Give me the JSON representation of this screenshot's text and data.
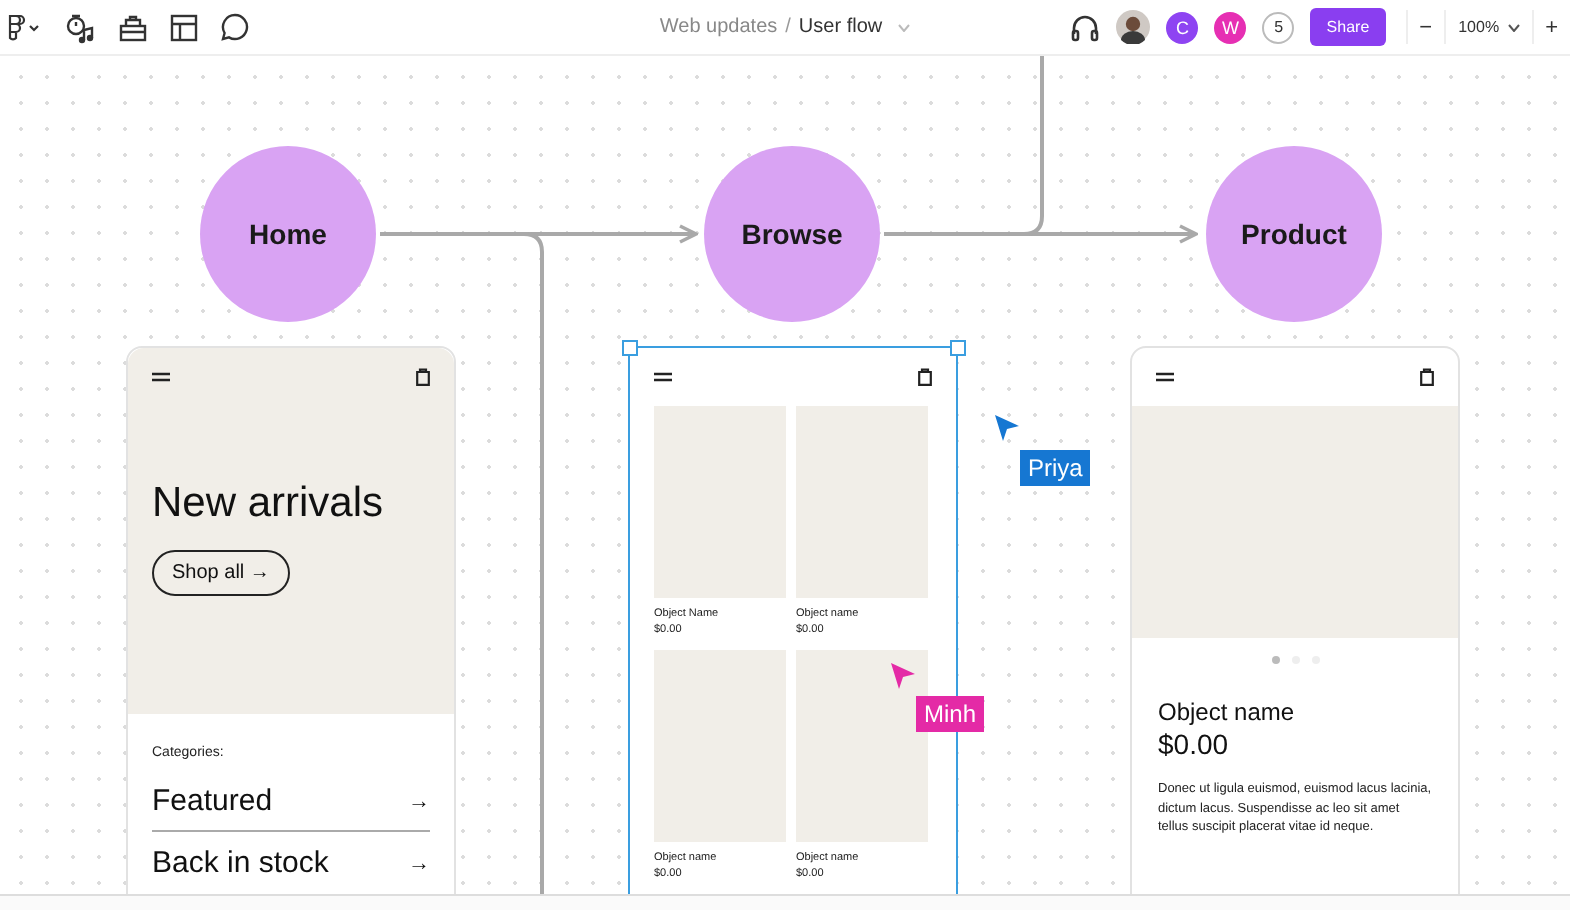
{
  "toolbar": {
    "breadcrumb": {
      "project": "Web updates",
      "separator": "/",
      "file": "User flow"
    },
    "collaborators": [
      {
        "kind": "photo"
      },
      {
        "kind": "initial",
        "initial": "C",
        "color": "#8e44f2"
      },
      {
        "kind": "initial",
        "initial": "W",
        "color": "#e62fb3"
      }
    ],
    "more_count": "5",
    "share_button": "Share",
    "zoom": {
      "minus": "−",
      "value": "100%",
      "plus": "+"
    }
  },
  "flow": {
    "nodes": [
      {
        "label": "Home"
      },
      {
        "label": "Browse"
      },
      {
        "label": "Product"
      }
    ]
  },
  "frames": [
    {
      "kind": "hero",
      "selected": false,
      "title": "New arrivals",
      "button": "Shop all →",
      "categories_label": "Categories:",
      "categories": [
        {
          "label": "Featured",
          "arrow": "→"
        },
        {
          "label": "Back in stock",
          "arrow": "→"
        }
      ]
    },
    {
      "kind": "grid",
      "selected": true,
      "products": [
        {
          "name": "Object Name",
          "price": "$0.00"
        },
        {
          "name": "Object name",
          "price": "$0.00"
        },
        {
          "name": "Object name",
          "price": "$0.00"
        },
        {
          "name": "Object name",
          "price": "$0.00"
        }
      ]
    },
    {
      "kind": "product",
      "selected": false,
      "dots": [
        {
          "selected": true
        },
        {
          "selected": false
        },
        {
          "selected": false
        }
      ],
      "title": "Object name",
      "price": "$0.00",
      "description": "Donec ut ligula euismod, euismod lacus lacinia, dictum lacus. Suspendisse ac leo sit amet tellus suscipit placerat vitae id neque."
    }
  ],
  "cursors": [
    {
      "name": "Priya",
      "color": "#1677d2"
    },
    {
      "name": "Minh",
      "color": "#e42aa6"
    }
  ]
}
